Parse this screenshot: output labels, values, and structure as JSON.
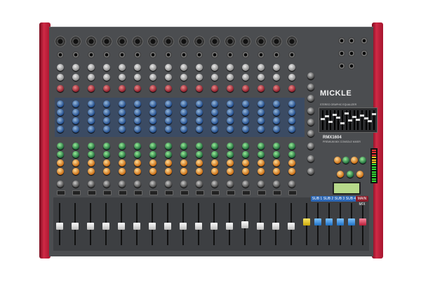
{
  "device": {
    "brand": "MICKLE",
    "model": "RMX1604",
    "subtitle": "PREMIUM MIX CONSOLE MIXER",
    "eq_label": "STEREO GRAPHIC EQUALIZER",
    "channel_count": 16,
    "sub_labels": [
      "SUB 1",
      "SUB 2",
      "SUB 3",
      "SUB 4"
    ],
    "main_label": "MAIN MIX"
  },
  "colors": {
    "cheek": "#c2223e",
    "panel": "#4b4d50",
    "eq_zone": "#2f4b73",
    "fader_white": "#f2f2f2",
    "fader_yellow": "#e8cc20",
    "fader_blue": "#3a8fe0",
    "fader_red": "#d8375a",
    "lcd": "#b7d98a"
  }
}
